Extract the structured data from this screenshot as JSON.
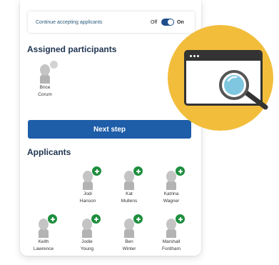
{
  "settings": {
    "accepting_label": "Continue accepting applicants",
    "off_label": "Off",
    "on_label": "On",
    "accepting_state": "on"
  },
  "assigned": {
    "title": "Assigned participants",
    "people": [
      {
        "first": "Brice",
        "last": "Corum"
      }
    ]
  },
  "actions": {
    "next_label": "Next step"
  },
  "applicants": {
    "title": "Applicants",
    "people": [
      {
        "first": "Jodi",
        "last": "Hanson"
      },
      {
        "first": "Kat",
        "last": "Mullens"
      },
      {
        "first": "Katrina",
        "last": "Wagner"
      },
      {
        "first": "Keith",
        "last": "Lawrence"
      },
      {
        "first": "Jodie",
        "last": "Young"
      },
      {
        "first": "Ben",
        "last": "Winter"
      },
      {
        "first": "Marshall",
        "last": "Fordham"
      }
    ]
  },
  "colors": {
    "primary": "#1e5da8",
    "add_badge": "#1e8e3e",
    "bubble": "#f2bd3b",
    "lens": "#7fc7e0"
  },
  "icons": {
    "avatar": "person-silhouette-icon",
    "add": "plus-circle-icon",
    "illustration": "browser-magnifier-icon"
  }
}
